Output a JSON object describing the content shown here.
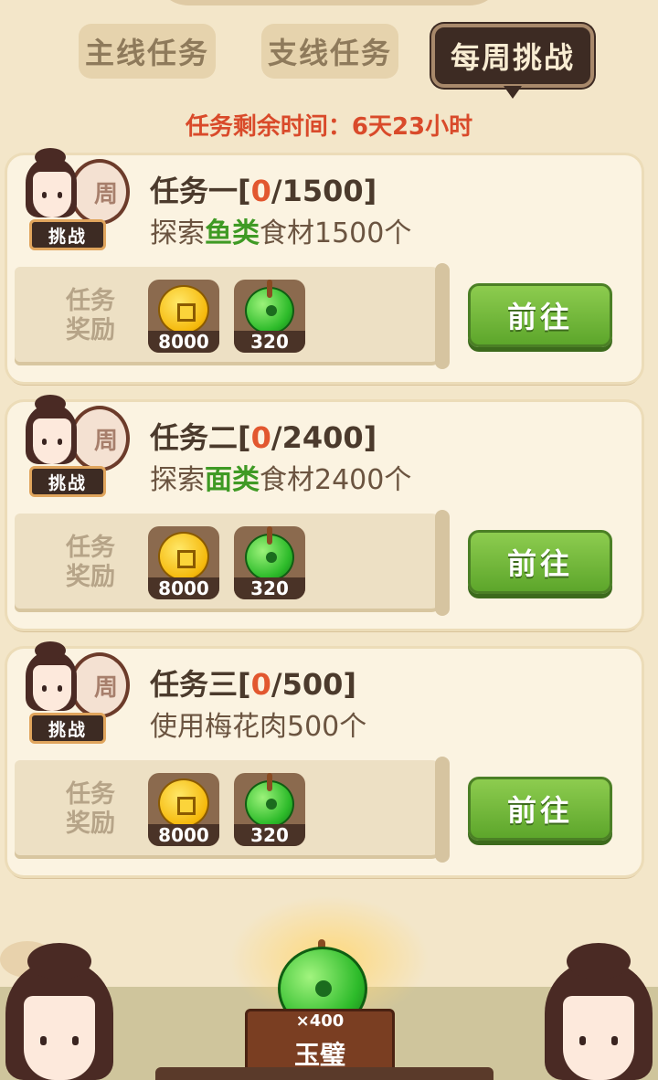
{
  "tabs": [
    {
      "label": "主线任务",
      "active": false
    },
    {
      "label": "支线任务",
      "active": false
    },
    {
      "label": "每周挑战",
      "active": true
    }
  ],
  "timer": {
    "label": "任务剩余时间：",
    "value": "6天23小时"
  },
  "avatar": {
    "drum_label": "周",
    "badge_label": "挑战"
  },
  "reward_label": "任务奖励",
  "go_label": "前往",
  "missions": [
    {
      "title_prefix": "任务一[",
      "progress": "0",
      "target": "/1500]",
      "desc_pre": "探索",
      "desc_hl": "鱼类",
      "desc_post": "食材1500个",
      "rewards": [
        {
          "icon": "coin-icon",
          "count": "8000"
        },
        {
          "icon": "jade-icon",
          "count": "320"
        }
      ]
    },
    {
      "title_prefix": "任务二[",
      "progress": "0",
      "target": "/2400]",
      "desc_pre": "探索",
      "desc_hl": "面类",
      "desc_post": "食材2400个",
      "rewards": [
        {
          "icon": "coin-icon",
          "count": "8000"
        },
        {
          "icon": "jade-icon",
          "count": "320"
        }
      ]
    },
    {
      "title_prefix": "任务三[",
      "progress": "0",
      "target": "/500]",
      "desc_pre": "使用梅花肉500个",
      "desc_hl": "",
      "desc_post": "",
      "rewards": [
        {
          "icon": "coin-icon",
          "count": "8000"
        },
        {
          "icon": "jade-icon",
          "count": "320"
        }
      ]
    }
  ],
  "grand_reward": {
    "qty": "×400",
    "name": "玉璧"
  },
  "colors": {
    "accent_green": "#5da62b",
    "progress_red": "#e2572f",
    "highlight_green": "#3f9a24",
    "timer_red": "#d94a2a"
  }
}
